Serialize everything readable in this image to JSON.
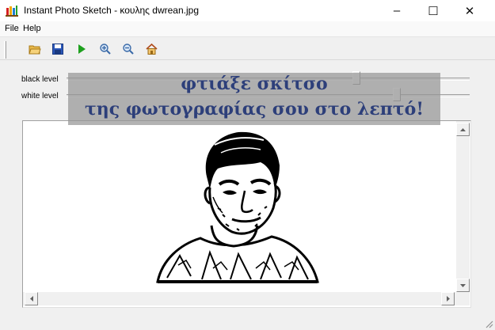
{
  "window": {
    "title": "Instant Photo Sketch - κουλης dwrean.jpg",
    "minimize_glyph": "–",
    "maximize_glyph": "☐",
    "close_glyph": "✕"
  },
  "menu": {
    "items": [
      "File",
      "Help"
    ]
  },
  "toolbar": {
    "buttons": [
      "open-folder-icon",
      "save-icon",
      "play-icon",
      "zoom-in-icon",
      "zoom-out-icon",
      "home-icon"
    ]
  },
  "sliders": {
    "black_label": "black level",
    "white_label": "white level",
    "black_value": 0.72,
    "white_value": 0.82
  },
  "overlay": {
    "line1": "φτιάξε σκίτσο",
    "line2": "της φωτογραφίας σου στο λεπτό!"
  },
  "colors": {
    "overlay_text": "#2d3f7a",
    "overlay_bg": "#969696",
    "play_green": "#1ea01e"
  }
}
